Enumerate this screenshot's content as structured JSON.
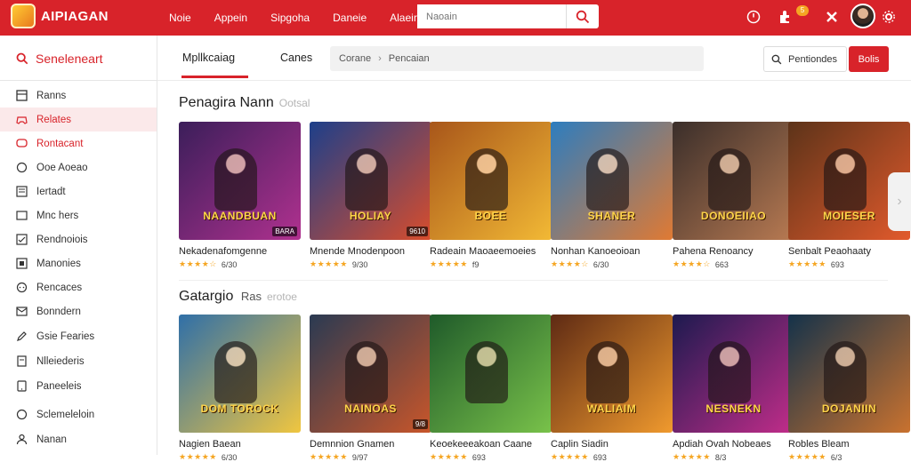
{
  "header": {
    "logo_text": "AIPIAGAN",
    "nav": [
      "Noie",
      "Appein",
      "Sipgoha",
      "Daneie",
      "Alaeire"
    ],
    "search_placeholder": "Naoain",
    "notif_count": "5"
  },
  "sidebar": {
    "title": "Seneleneart",
    "items": [
      {
        "label": "Ranns",
        "icon": "grid-icon"
      },
      {
        "label": "Relates",
        "icon": "controller-icon",
        "active": true
      },
      {
        "label": "Rontacant",
        "icon": "chat-icon",
        "red": true
      },
      {
        "label": "Ooe Aoeao",
        "icon": "globe-icon"
      },
      {
        "label": "Iertadt",
        "icon": "list-icon"
      },
      {
        "label": "Mnc hers",
        "icon": "window-icon"
      },
      {
        "label": "Rendnoiois",
        "icon": "check-icon"
      },
      {
        "label": "Manonies",
        "icon": "square-icon"
      },
      {
        "label": "Rencaces",
        "icon": "message-icon"
      },
      {
        "label": "Bonndern",
        "icon": "mail-icon"
      },
      {
        "label": "Gsie Fearies",
        "icon": "pencil-icon"
      },
      {
        "label": "Nlleiederis",
        "icon": "doc-icon"
      },
      {
        "label": "Paneeleis",
        "icon": "tablet-icon"
      },
      {
        "label": "Sclemeleloin",
        "icon": "circle-icon"
      },
      {
        "label": "Nanan",
        "icon": "user-icon"
      }
    ]
  },
  "subheader": {
    "tab_active": "Mpllkcaiag",
    "tab_other": "Canes",
    "crumb_1": "Corane",
    "crumb_sep": "›",
    "crumb_2": "Pencaian",
    "filter_label": "Pentiondes",
    "action_label": "Bolis"
  },
  "sections": [
    {
      "title": "Penagira Nann",
      "muted": "Ootsal",
      "cards": [
        {
          "title": "Nekadenafomgenne",
          "rating": "★★★★☆",
          "meta": "6/30",
          "banner": "NAANDBUAN",
          "tag": "BARA",
          "c1": "#3b1e5a",
          "c2": "#b0318f"
        },
        {
          "title": "Mnende Mnodenpoon",
          "rating": "★★★★★",
          "meta": "9/30",
          "banner": "HOLIAY",
          "tag": "9610",
          "c1": "#1d3f8a",
          "c2": "#d94d2c"
        },
        {
          "title": "Radeain Maoaeemoeies",
          "rating": "★★★★★",
          "meta": "f9",
          "banner": "BOEE",
          "tag": "",
          "c1": "#a8561a",
          "c2": "#f2b935"
        },
        {
          "title": "Nonhan Kanoeoioan",
          "rating": "★★★★☆",
          "meta": "6/30",
          "banner": "SHANER",
          "tag": "",
          "c1": "#2d7dbf",
          "c2": "#e07a33"
        },
        {
          "title": "Pahena Renoancy",
          "rating": "★★★★☆",
          "meta": "663",
          "banner": "DONOEIIAO",
          "tag": "",
          "c1": "#3a2e2a",
          "c2": "#b87a52"
        },
        {
          "title": "Senbalt Peaohaaty",
          "rating": "★★★★★",
          "meta": "693",
          "banner": "MOIESER",
          "tag": "",
          "c1": "#5c3319",
          "c2": "#e25a2c"
        }
      ]
    },
    {
      "title": "Gatargio",
      "muted_dark": "Ras",
      "muted": "erotoe",
      "cards": [
        {
          "title": "Nagien Baean",
          "rating": "★★★★★",
          "meta": "6/30",
          "banner": "DOM TOROCK",
          "tag": "",
          "c1": "#2f6fa8",
          "c2": "#f0c640"
        },
        {
          "title": "Demnnion Gnamen",
          "rating": "★★★★★",
          "meta": "9/97",
          "banner": "NAINOAS",
          "tag": "9/8",
          "c1": "#2a3a52",
          "c2": "#c9562a"
        },
        {
          "title": "Keoekeeeakoan Caane",
          "rating": "★★★★★",
          "meta": "693",
          "banner": "",
          "tag": "",
          "c1": "#1f5a2a",
          "c2": "#79c24a"
        },
        {
          "title": "Caplin Siadin",
          "rating": "★★★★★",
          "meta": "693",
          "banner": "WALIAIM",
          "tag": "",
          "c1": "#5e2a14",
          "c2": "#f09a2e"
        },
        {
          "title": "Apdiah Ovah Nobeaes",
          "rating": "★★★★★",
          "meta": "8/3",
          "banner": "NESNEKN",
          "tag": "",
          "c1": "#1d1a4f",
          "c2": "#c22d8a"
        },
        {
          "title": "Robles Bleam",
          "rating": "★★★★★",
          "meta": "6/3",
          "banner": "DOJANIIN",
          "tag": "",
          "c1": "#14324a",
          "c2": "#c9722f"
        }
      ]
    }
  ],
  "colors": {
    "accent": "#d8232a",
    "star": "#f5a623"
  }
}
